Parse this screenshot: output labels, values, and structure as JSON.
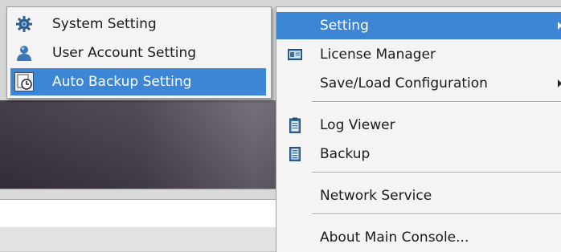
{
  "submenu": {
    "items": [
      {
        "label": "System Setting",
        "icon": "gear-icon"
      },
      {
        "label": "User Account Setting",
        "icon": "user-icon"
      },
      {
        "label": "Auto Backup Setting",
        "icon": "clock-backup-icon",
        "highlighted": true
      }
    ]
  },
  "main_menu": {
    "items": [
      {
        "label": "Setting",
        "icon": "",
        "highlighted": true,
        "has_submenu": true
      },
      {
        "label": "License Manager",
        "icon": "license-card-icon"
      },
      {
        "label": "Save/Load Configuration",
        "icon": "",
        "has_submenu": true
      },
      {
        "label": "Log Viewer",
        "icon": "clipboard-icon"
      },
      {
        "label": "Backup",
        "icon": "backup-list-icon"
      },
      {
        "label": "Network Service",
        "icon": ""
      },
      {
        "label": "About Main Console...",
        "icon": ""
      }
    ]
  },
  "colors": {
    "highlight": "#3d86d6",
    "menu_background": "#f4f4f4"
  }
}
